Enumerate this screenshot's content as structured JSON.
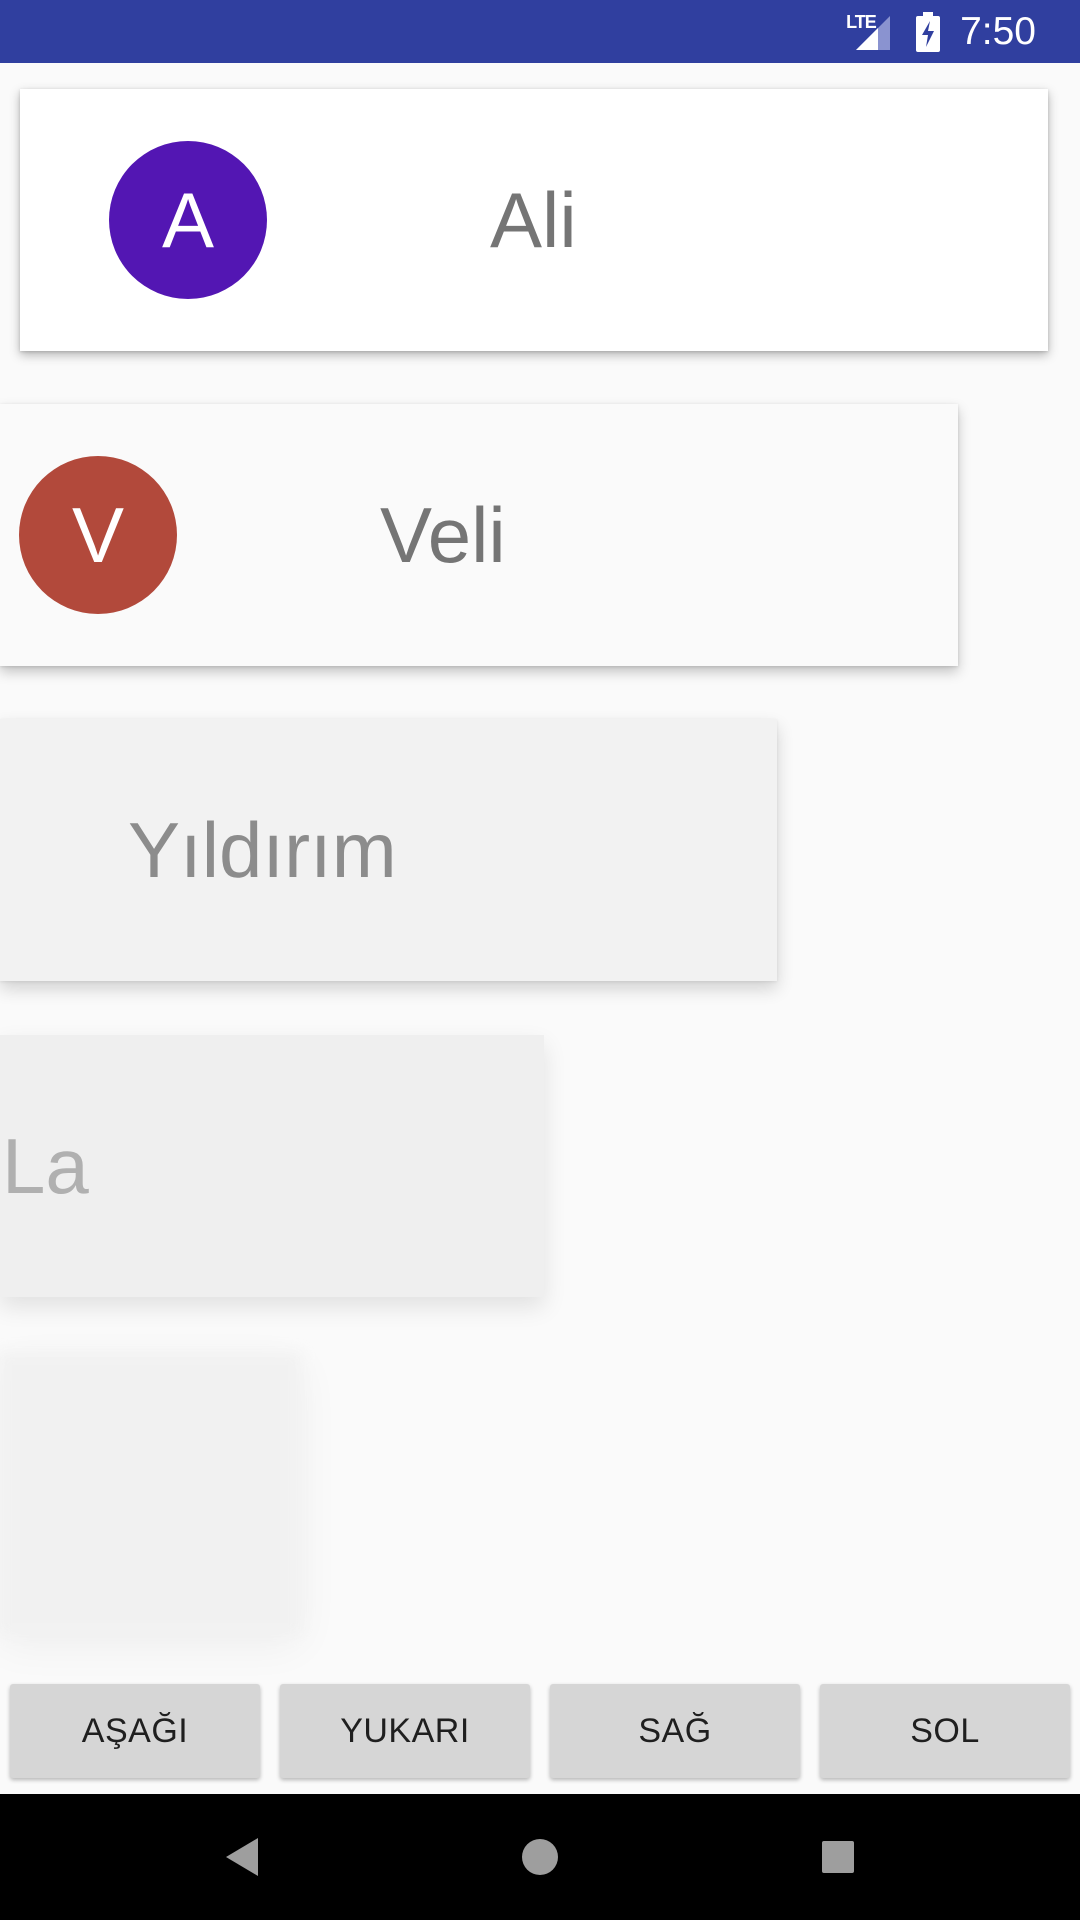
{
  "status_bar": {
    "network_label": "LTE",
    "time": "7:50",
    "background_color": "#303f9f",
    "icons": [
      "lte-signal-icon",
      "battery-charging-icon"
    ]
  },
  "cards": [
    {
      "initial": "A",
      "name": "Ali",
      "avatar_color": "#5316b3"
    },
    {
      "initial": "V",
      "name": "Veli",
      "avatar_color": "#b2493b"
    },
    {
      "name": "Yıldırım"
    },
    {
      "name": "La"
    },
    {}
  ],
  "buttons": {
    "down": "AŞAĞI",
    "up": "YUKARI",
    "right": "SAĞ",
    "left": "SOL"
  },
  "nav_bar": {
    "icons": [
      "back-icon",
      "home-icon",
      "recents-icon"
    ]
  }
}
